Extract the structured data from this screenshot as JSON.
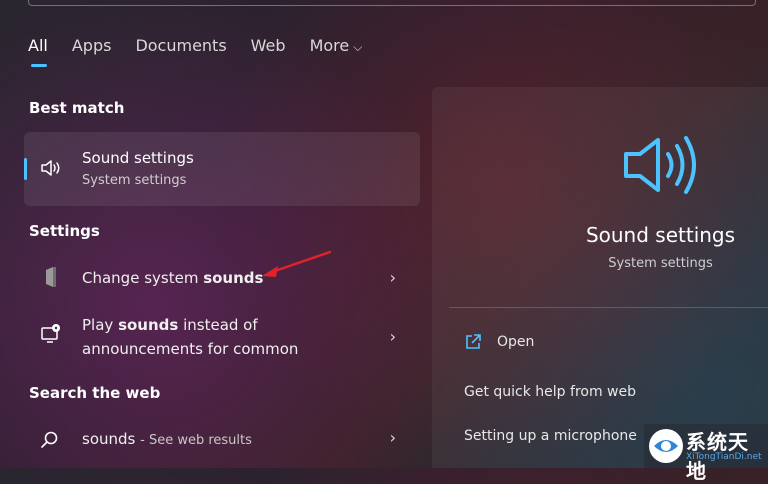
{
  "tabs": [
    {
      "label": "All",
      "active": true
    },
    {
      "label": "Apps"
    },
    {
      "label": "Documents"
    },
    {
      "label": "Web"
    },
    {
      "label": "More"
    }
  ],
  "sections": {
    "best_match": "Best match",
    "settings": "Settings",
    "search_web": "Search the web"
  },
  "best_match": {
    "title": "Sound settings",
    "subtitle": "System settings",
    "icon": "speaker-icon"
  },
  "settings_items": [
    {
      "pre": "Change system ",
      "bold": "sounds",
      "post": "",
      "icon": "sound-device-icon"
    },
    {
      "pre": "Play ",
      "bold": "sounds",
      "post": " instead of",
      "line2": "announcements for common",
      "icon": "monitor-notification-icon"
    }
  ],
  "web_result": {
    "query": "sounds",
    "suffix": "- See web results",
    "icon": "search-icon"
  },
  "preview": {
    "title": "Sound settings",
    "subtitle": "System settings",
    "actions": [
      "Open",
      "Get quick help from web",
      "Setting up a microphone"
    ]
  },
  "watermark": {
    "text": "系统天地",
    "url": "XiTongTianDi.net"
  },
  "colors": {
    "accent": "#4cc2ff",
    "annotation_arrow": "#e0222a"
  }
}
